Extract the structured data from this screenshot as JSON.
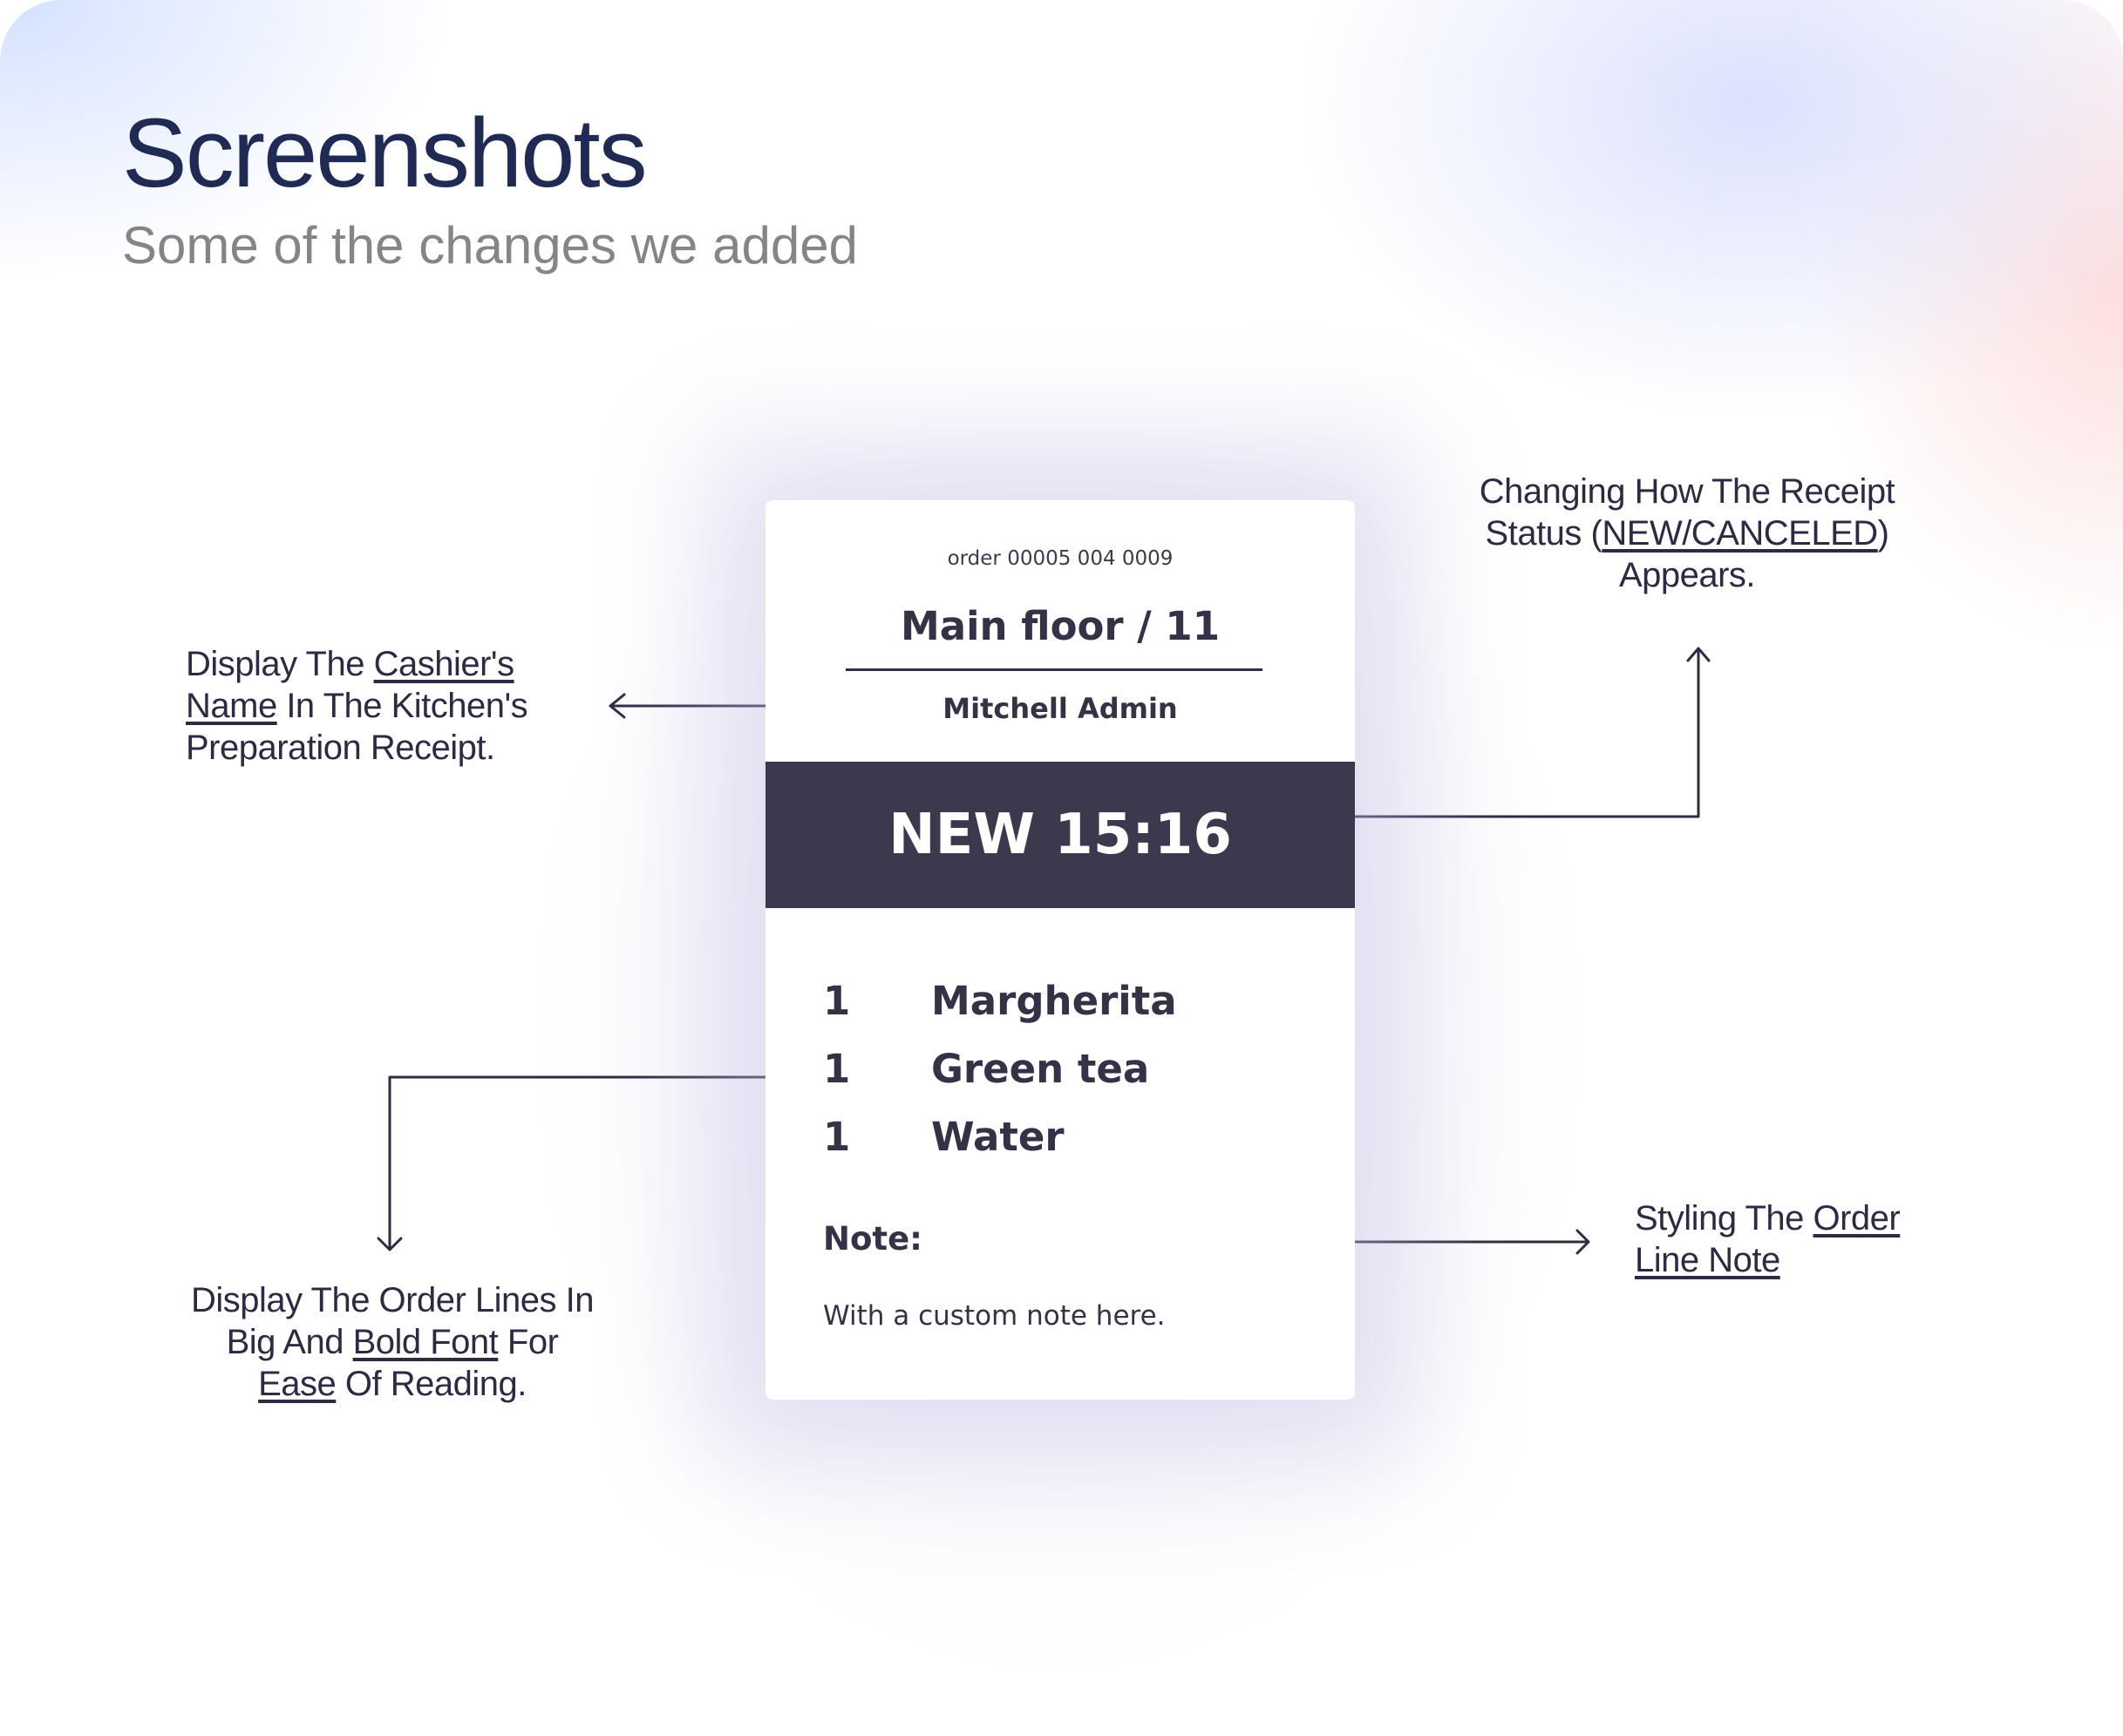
{
  "header": {
    "title": "Screenshots",
    "subtitle": "Some of the changes we added"
  },
  "receipt": {
    "order_ref": "order 00005 004 0009",
    "table": "Main floor / 11",
    "cashier": "Mitchell Admin",
    "status": "NEW 15:16",
    "lines": [
      {
        "qty": "1",
        "product": "Margherita"
      },
      {
        "qty": "1",
        "product": "Green tea"
      },
      {
        "qty": "1",
        "product": "Water"
      }
    ],
    "note_label": "Note:",
    "note_text": "With a custom note here."
  },
  "annotations": {
    "cashier": {
      "p1": "Display The ",
      "u1": "Cashier's",
      "u2": "Name",
      "p2": " In The Kitchen's",
      "p3": "Preparation Receipt."
    },
    "status": {
      "p1": "Changing How The Receipt",
      "p2": "Status (",
      "u1": "NEW/CANCELED",
      "p3": ")",
      "p4": "Appears."
    },
    "lines": {
      "p1": "Display The Order Lines In",
      "p2": "Big And ",
      "u1": "Bold Font",
      "p3": " For",
      "u2": "Ease",
      "p4": " Of Reading."
    },
    "note": {
      "p1": "Styling The ",
      "u1": "Order",
      "u2": "Line Note"
    }
  },
  "colors": {
    "heading": "#1f2a55",
    "subheading": "#858585",
    "status_bar": "#3d384d",
    "ink": "#2c2b44"
  }
}
